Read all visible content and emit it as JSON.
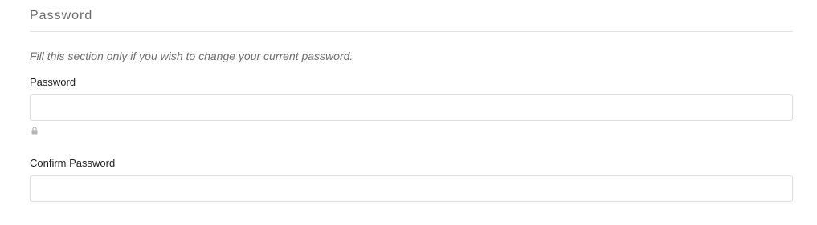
{
  "section": {
    "title": "Password",
    "hint": "Fill this section only if you wish to change your current password."
  },
  "fields": {
    "password": {
      "label": "Password",
      "value": "",
      "placeholder": "",
      "icon": "lock-icon"
    },
    "confirm_password": {
      "label": "Confirm Password",
      "value": "",
      "placeholder": ""
    }
  },
  "colors": {
    "title": "#6b6b6b",
    "hint": "#6f6f6f",
    "label": "#222222",
    "border": "#dcdcdc",
    "divider": "#e2e2e2",
    "icon": "#b5b5b5"
  }
}
